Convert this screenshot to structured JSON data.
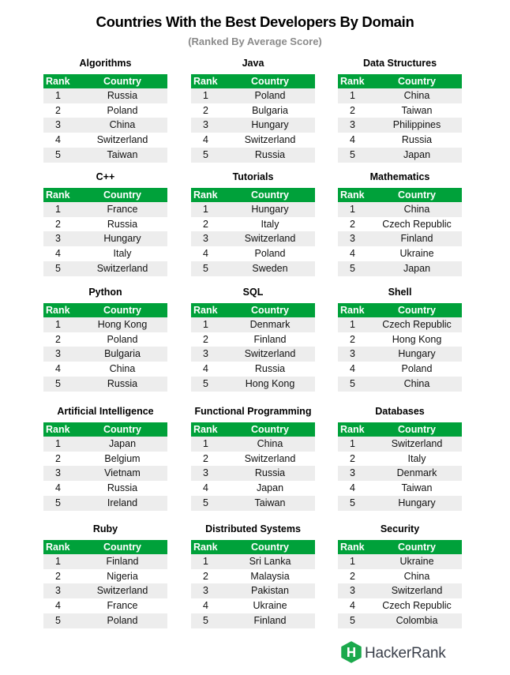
{
  "header": {
    "title": "Countries With the Best Developers By Domain",
    "subtitle": "(Ranked By Average Score)"
  },
  "columns": {
    "rank": "Rank",
    "country": "Country"
  },
  "colors": {
    "header_green": "#00a13a",
    "row_stripe": "#ededed",
    "subtitle_gray": "#8a8a8a",
    "logo_green": "#1ba94c"
  },
  "domains": [
    {
      "name": "Algorithms",
      "rows": [
        {
          "rank": "1",
          "country": "Russia"
        },
        {
          "rank": "2",
          "country": "Poland"
        },
        {
          "rank": "3",
          "country": "China"
        },
        {
          "rank": "4",
          "country": "Switzerland"
        },
        {
          "rank": "5",
          "country": "Taiwan"
        }
      ]
    },
    {
      "name": "Java",
      "rows": [
        {
          "rank": "1",
          "country": "Poland"
        },
        {
          "rank": "2",
          "country": "Bulgaria"
        },
        {
          "rank": "3",
          "country": "Hungary"
        },
        {
          "rank": "4",
          "country": "Switzerland"
        },
        {
          "rank": "5",
          "country": "Russia"
        }
      ]
    },
    {
      "name": "Data Structures",
      "rows": [
        {
          "rank": "1",
          "country": "China"
        },
        {
          "rank": "2",
          "country": "Taiwan"
        },
        {
          "rank": "3",
          "country": "Philippines"
        },
        {
          "rank": "4",
          "country": "Russia"
        },
        {
          "rank": "5",
          "country": "Japan"
        }
      ]
    },
    {
      "name": "C++",
      "rows": [
        {
          "rank": "1",
          "country": "France"
        },
        {
          "rank": "2",
          "country": "Russia"
        },
        {
          "rank": "3",
          "country": "Hungary"
        },
        {
          "rank": "4",
          "country": "Italy"
        },
        {
          "rank": "5",
          "country": "Switzerland"
        }
      ]
    },
    {
      "name": "Tutorials",
      "rows": [
        {
          "rank": "1",
          "country": "Hungary"
        },
        {
          "rank": "2",
          "country": "Italy"
        },
        {
          "rank": "3",
          "country": "Switzerland"
        },
        {
          "rank": "4",
          "country": "Poland"
        },
        {
          "rank": "5",
          "country": "Sweden"
        }
      ]
    },
    {
      "name": "Mathematics",
      "rows": [
        {
          "rank": "1",
          "country": "China"
        },
        {
          "rank": "2",
          "country": "Czech Republic"
        },
        {
          "rank": "3",
          "country": "Finland"
        },
        {
          "rank": "4",
          "country": "Ukraine"
        },
        {
          "rank": "5",
          "country": "Japan"
        }
      ]
    },
    {
      "name": "Python",
      "rows": [
        {
          "rank": "1",
          "country": "Hong Kong"
        },
        {
          "rank": "2",
          "country": "Poland"
        },
        {
          "rank": "3",
          "country": "Bulgaria"
        },
        {
          "rank": "4",
          "country": "China"
        },
        {
          "rank": "5",
          "country": "Russia"
        }
      ]
    },
    {
      "name": "SQL",
      "rows": [
        {
          "rank": "1",
          "country": "Denmark"
        },
        {
          "rank": "2",
          "country": "Finland"
        },
        {
          "rank": "3",
          "country": "Switzerland"
        },
        {
          "rank": "4",
          "country": "Russia"
        },
        {
          "rank": "5",
          "country": "Hong Kong"
        }
      ]
    },
    {
      "name": "Shell",
      "rows": [
        {
          "rank": "1",
          "country": "Czech Republic"
        },
        {
          "rank": "2",
          "country": "Hong Kong"
        },
        {
          "rank": "3",
          "country": "Hungary"
        },
        {
          "rank": "4",
          "country": "Poland"
        },
        {
          "rank": "5",
          "country": "China"
        }
      ]
    },
    {
      "name": "Artificial Intelligence",
      "rows": [
        {
          "rank": "1",
          "country": "Japan"
        },
        {
          "rank": "2",
          "country": "Belgium"
        },
        {
          "rank": "3",
          "country": "Vietnam"
        },
        {
          "rank": "4",
          "country": "Russia"
        },
        {
          "rank": "5",
          "country": "Ireland"
        }
      ]
    },
    {
      "name": "Functional Programming",
      "rows": [
        {
          "rank": "1",
          "country": "China"
        },
        {
          "rank": "2",
          "country": "Switzerland"
        },
        {
          "rank": "3",
          "country": "Russia"
        },
        {
          "rank": "4",
          "country": "Japan"
        },
        {
          "rank": "5",
          "country": "Taiwan"
        }
      ]
    },
    {
      "name": "Databases",
      "rows": [
        {
          "rank": "1",
          "country": "Switzerland"
        },
        {
          "rank": "2",
          "country": "Italy"
        },
        {
          "rank": "3",
          "country": "Denmark"
        },
        {
          "rank": "4",
          "country": "Taiwan"
        },
        {
          "rank": "5",
          "country": "Hungary"
        }
      ]
    },
    {
      "name": "Ruby",
      "rows": [
        {
          "rank": "1",
          "country": "Finland"
        },
        {
          "rank": "2",
          "country": "Nigeria"
        },
        {
          "rank": "3",
          "country": "Switzerland"
        },
        {
          "rank": "4",
          "country": "France"
        },
        {
          "rank": "5",
          "country": "Poland"
        }
      ]
    },
    {
      "name": "Distributed Systems",
      "rows": [
        {
          "rank": "1",
          "country": "Sri Lanka"
        },
        {
          "rank": "2",
          "country": "Malaysia"
        },
        {
          "rank": "3",
          "country": "Pakistan"
        },
        {
          "rank": "4",
          "country": "Ukraine"
        },
        {
          "rank": "5",
          "country": "Finland"
        }
      ]
    },
    {
      "name": "Security",
      "rows": [
        {
          "rank": "1",
          "country": "Ukraine"
        },
        {
          "rank": "2",
          "country": "China"
        },
        {
          "rank": "3",
          "country": "Switzerland"
        },
        {
          "rank": "4",
          "country": "Czech Republic"
        },
        {
          "rank": "5",
          "country": "Colombia"
        }
      ]
    }
  ],
  "logo": {
    "icon": "hackerrank-hexagon-icon",
    "text": "HackerRank"
  }
}
